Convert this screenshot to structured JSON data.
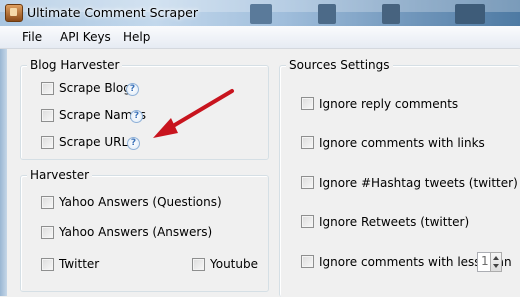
{
  "window": {
    "title": "Ultimate Comment Scraper"
  },
  "menu": {
    "items": [
      "File",
      "API Keys",
      "Help"
    ]
  },
  "blog_harvester": {
    "title": "Blog Harvester",
    "options": [
      {
        "label": "Scrape Blogs",
        "checked": false,
        "help": "?"
      },
      {
        "label": "Scrape Names",
        "checked": false,
        "help": "?"
      },
      {
        "label": "Scrape URLs",
        "checked": false,
        "help": "?"
      }
    ]
  },
  "harvester": {
    "title": "Harvester",
    "options": [
      {
        "label": "Yahoo Answers (Questions)",
        "checked": false
      },
      {
        "label": "Yahoo Answers (Answers)",
        "checked": false
      },
      {
        "label": "Twitter",
        "checked": false
      },
      {
        "label": "Youtube",
        "checked": false
      }
    ]
  },
  "sources_settings": {
    "title": "Sources Settings",
    "options": [
      {
        "label": "Ignore reply comments",
        "checked": false
      },
      {
        "label": "Ignore comments with links",
        "checked": false
      },
      {
        "label": "Ignore #Hashtag tweets (twitter)",
        "checked": false
      },
      {
        "label": "Ignore Retweets (twitter)",
        "checked": false
      },
      {
        "label": "Ignore comments with less than",
        "checked": false
      }
    ],
    "min_length_value": "1"
  },
  "colors": {
    "annotation_arrow": "#c8141e",
    "title_bar": "#9fbddb"
  }
}
